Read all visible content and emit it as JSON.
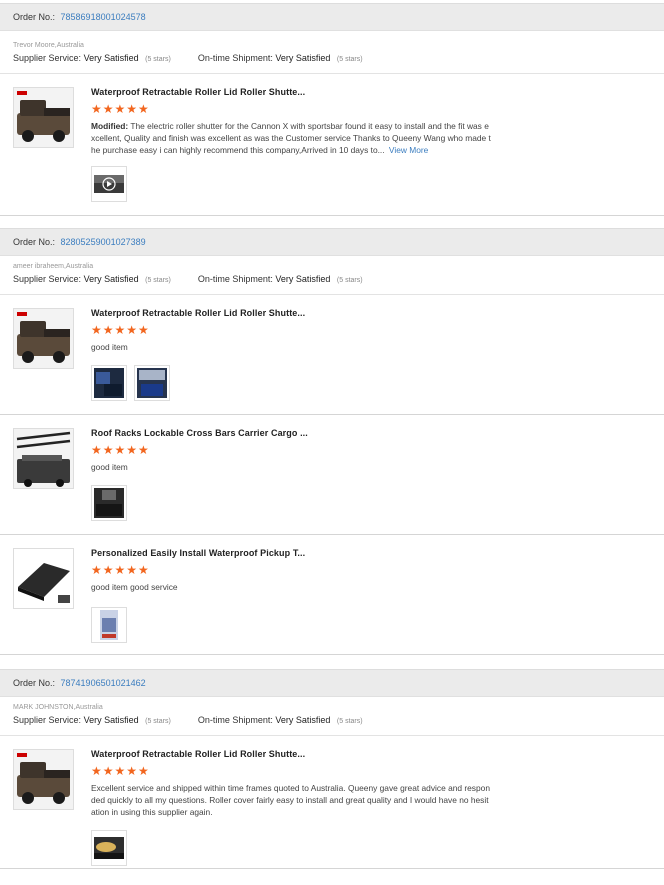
{
  "orders": [
    {
      "label": "Order No.:",
      "number": "78586918001024578",
      "buyer": "Trevor Moore,Australia",
      "supplier_label": "Supplier Service:",
      "supplier_value": "Very Satisfied",
      "supplier_note": "(5 stars)",
      "shipment_label": "On-time Shipment:",
      "shipment_value": "Very Satisfied",
      "shipment_note": "(5 stars)",
      "items": [
        {
          "title": "Waterproof Retractable Roller Lid Roller Shutte...",
          "rating": 5,
          "stars": "★★★★★",
          "prefix": "Modified:",
          "comment": "The electric roller shutter for the Cannon X with sportsbar found it easy to install and the fit was excellent, Quality and finish was excellent as was the Customer service Thanks to  Queeny Wang who made the purchase easy i can highly recommend this company,Arrived in 10 days to...",
          "more": "View More"
        }
      ]
    },
    {
      "label": "Order No.:",
      "number": "82805259001027389",
      "buyer": "ameer ibraheem,Australia",
      "supplier_label": "Supplier Service:",
      "supplier_value": "Very Satisfied",
      "supplier_note": "(5 stars)",
      "shipment_label": "On-time Shipment:",
      "shipment_value": "Very Satisfied",
      "shipment_note": "(5 stars)",
      "items": [
        {
          "title": "Waterproof Retractable Roller Lid Roller Shutte...",
          "rating": 5,
          "stars": "★★★★★",
          "comment": "good item"
        },
        {
          "title": "Roof Racks Lockable Cross Bars Carrier Cargo ...",
          "rating": 5,
          "stars": "★★★★★",
          "comment": "good item"
        },
        {
          "title": "Personalized Easily Install Waterproof Pickup T...",
          "rating": 5,
          "stars": "★★★★★",
          "comment": "good item good service"
        }
      ]
    },
    {
      "label": "Order No.:",
      "number": "78741906501021462",
      "buyer": "MARK JOHNSTON,Australia",
      "supplier_label": "Supplier Service:",
      "supplier_value": "Very Satisfied",
      "supplier_note": "(5 stars)",
      "shipment_label": "On-time Shipment:",
      "shipment_value": "Very Satisfied",
      "shipment_note": "(5 stars)",
      "items": [
        {
          "title": "Waterproof Retractable Roller Lid Roller Shutte...",
          "rating": 5,
          "stars": "★★★★★",
          "comment": "Excellent service and shipped within time frames quoted to Australia. Queeny gave great advice and responded quickly to all my questions. Roller cover fairly easy to install and great quality and I would have no hesitation in using this supplier again."
        }
      ]
    }
  ],
  "colors": {
    "link": "#3b7dbf",
    "star": "#f2661f",
    "header_bg": "#ebebeb"
  }
}
